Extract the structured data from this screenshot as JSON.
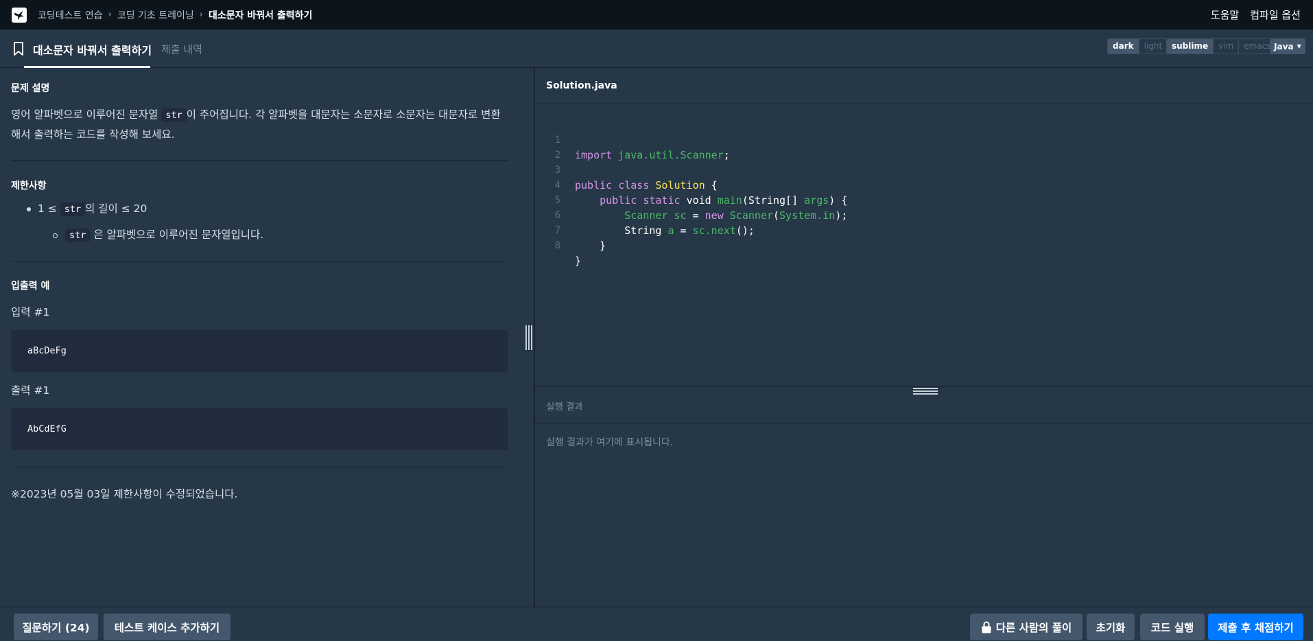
{
  "topnav": {
    "breadcrumbs": [
      "코딩테스트 연습",
      "코딩 기초 트레이닝",
      "대소문자 바꿔서 출력하기"
    ],
    "help": "도움말",
    "compile_options": "컴파일 옵션"
  },
  "tabs": {
    "active": "대소문자 바꿔서 출력하기",
    "submissions": "제출 내역"
  },
  "editor_options": {
    "theme": [
      "dark",
      "light"
    ],
    "theme_selected": "dark",
    "keymap": [
      "sublime",
      "vim",
      "emacs"
    ],
    "keymap_selected": "sublime",
    "language": "Java"
  },
  "problem": {
    "description_title": "문제 설명",
    "description_before": "영어 알파벳으로 이루어진 문자열 ",
    "description_code": "str",
    "description_after": "이 주어집니다. 각 알파벳을 대문자는 소문자로 소문자는 대문자로 변환해서 출력하는 코드를 작성해 보세요.",
    "constraints_title": "제한사항",
    "constraint1_prefix": "1 ≤ ",
    "constraint1_code": "str",
    "constraint1_suffix": "의 길이 ≤ 20",
    "constraint2_code": "str",
    "constraint2_suffix": "은 알파벳으로 이루어진 문자열입니다.",
    "io_title": "입출력 예",
    "input_label": "입력 #1",
    "input_value": "aBcDeFg",
    "output_label": "출력 #1",
    "output_value": "AbCdEfG",
    "note": "※2023년 05월 03일 제한사항이 수정되었습니다."
  },
  "editor": {
    "filename": "Solution.java",
    "line_numbers": [
      "1",
      "2",
      "3",
      "4",
      "5",
      "6",
      "7",
      "8"
    ],
    "code": {
      "l1_import": "import",
      "l1_pkg": "java.util.Scanner",
      "l1_semi": ";",
      "l3_public": "public",
      "l3_class": "class",
      "l3_name": "Solution",
      "l3_brace": "{",
      "l4_mods": "public static",
      "l4_void": "void",
      "l4_main": "main",
      "l4_sig": "(String[]",
      "l4_args": "args",
      "l4_end": ") {",
      "l5_type": "Scanner",
      "l5_var": "sc",
      "l5_eq": "=",
      "l5_new": "new",
      "l5_ctor": "Scanner",
      "l5_paren": "(",
      "l5_sysin": "System.in",
      "l5_end": ");",
      "l6_type": "String",
      "l6_var": "a",
      "l6_eq": "=",
      "l6_call": "sc.next",
      "l6_end": "();",
      "l7": "}",
      "l8": "}"
    }
  },
  "result": {
    "title": "실행 결과",
    "placeholder": "실행 결과가 여기에 표시됩니다."
  },
  "footer": {
    "ask": "질문하기 (24)",
    "add_testcase": "테스트 케이스 추가하기",
    "others_solution": "다른 사람의 풀이",
    "reset": "초기화",
    "run": "코드 실행",
    "submit": "제출 후 채점하기"
  }
}
